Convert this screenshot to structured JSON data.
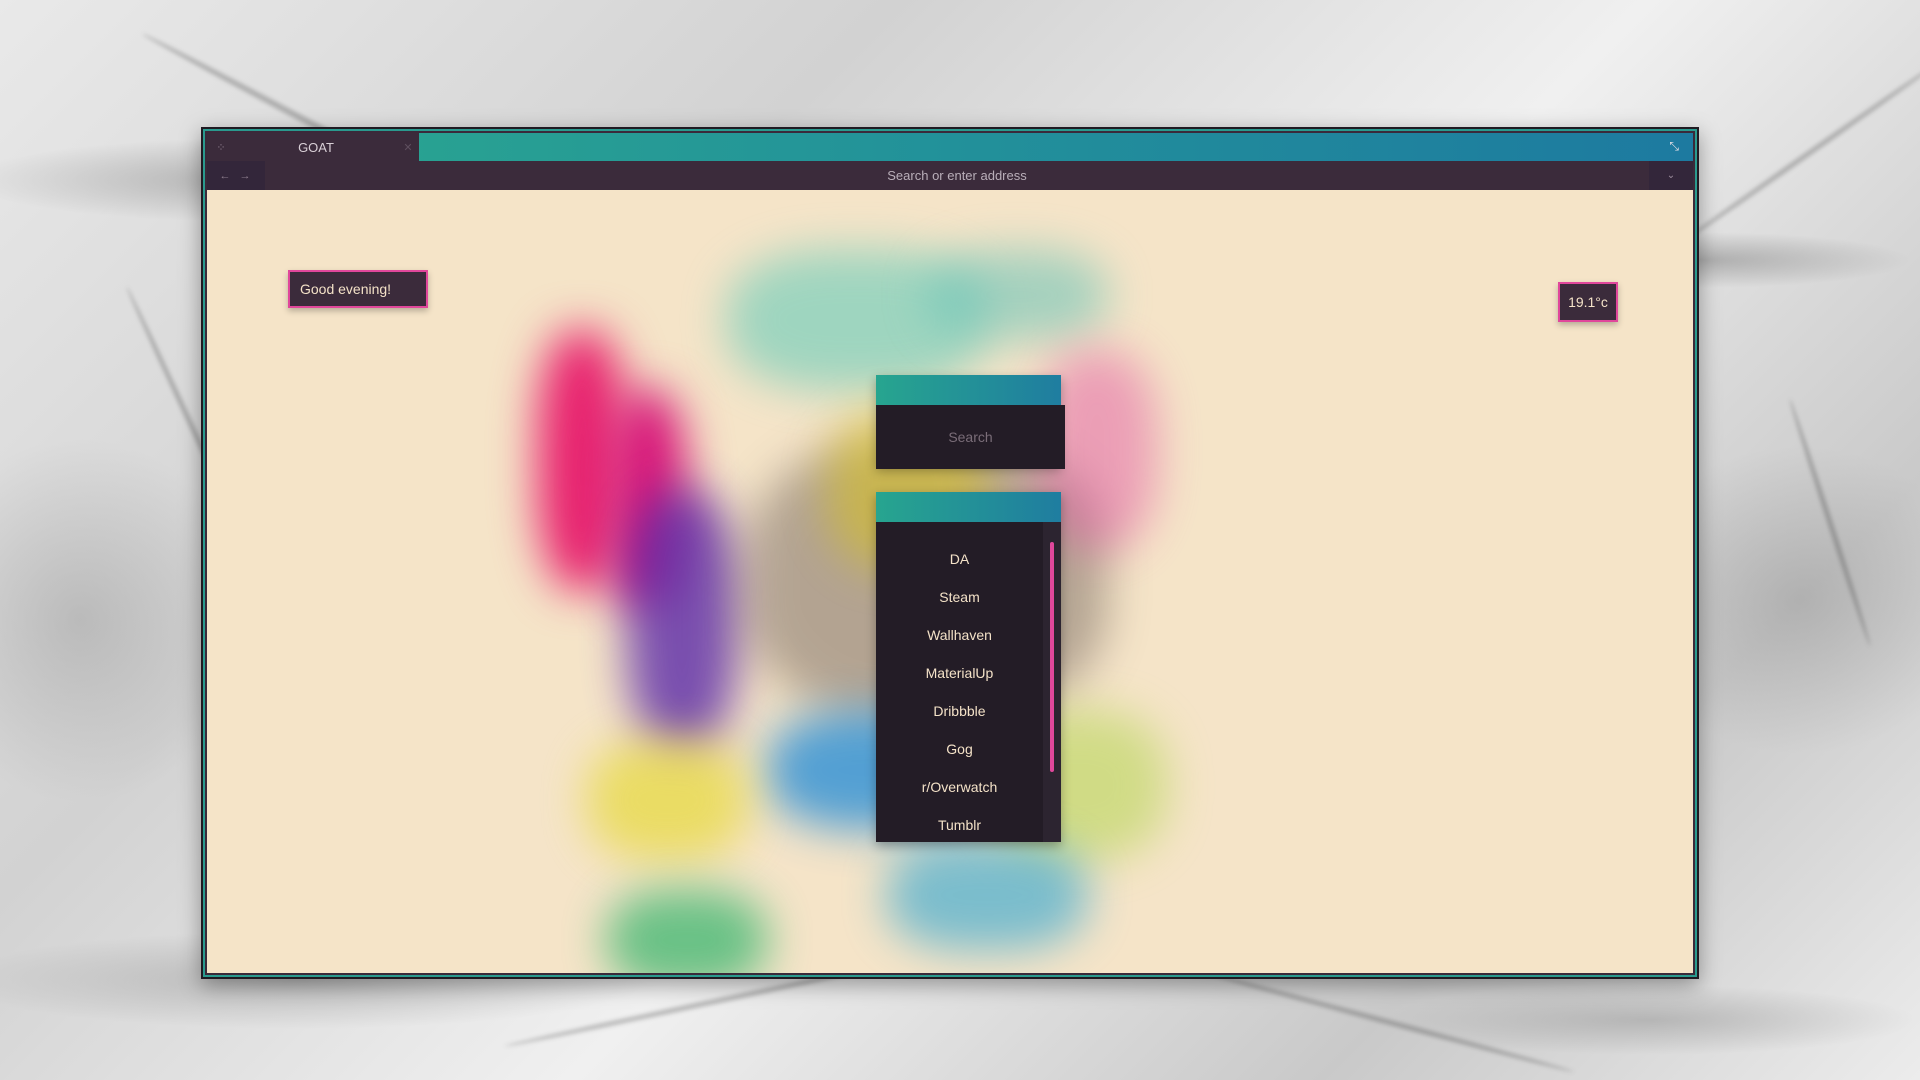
{
  "browser": {
    "tab": {
      "title": "GOAT",
      "grip_icon": "⁘",
      "close_icon": "✕"
    },
    "window_control_icon": "⤡",
    "nav": {
      "back": "←",
      "forward": "→"
    },
    "address": {
      "placeholder": "Search or enter address"
    },
    "dropdown_icon": "⌄"
  },
  "page": {
    "greeting": "Good evening!",
    "weather": "19.1°c",
    "search": {
      "placeholder": "Search"
    },
    "links": [
      "DA",
      "Steam",
      "Wallhaven",
      "MaterialUp",
      "Dribbble",
      "Gog",
      "r/Overwatch",
      "Tumblr"
    ]
  },
  "colors": {
    "accent_pink": "#e0479b",
    "gradient_start": "#2ba88f",
    "gradient_end": "#1d7aa0",
    "panel": "#231c26",
    "cream": "#f5e4c8"
  }
}
